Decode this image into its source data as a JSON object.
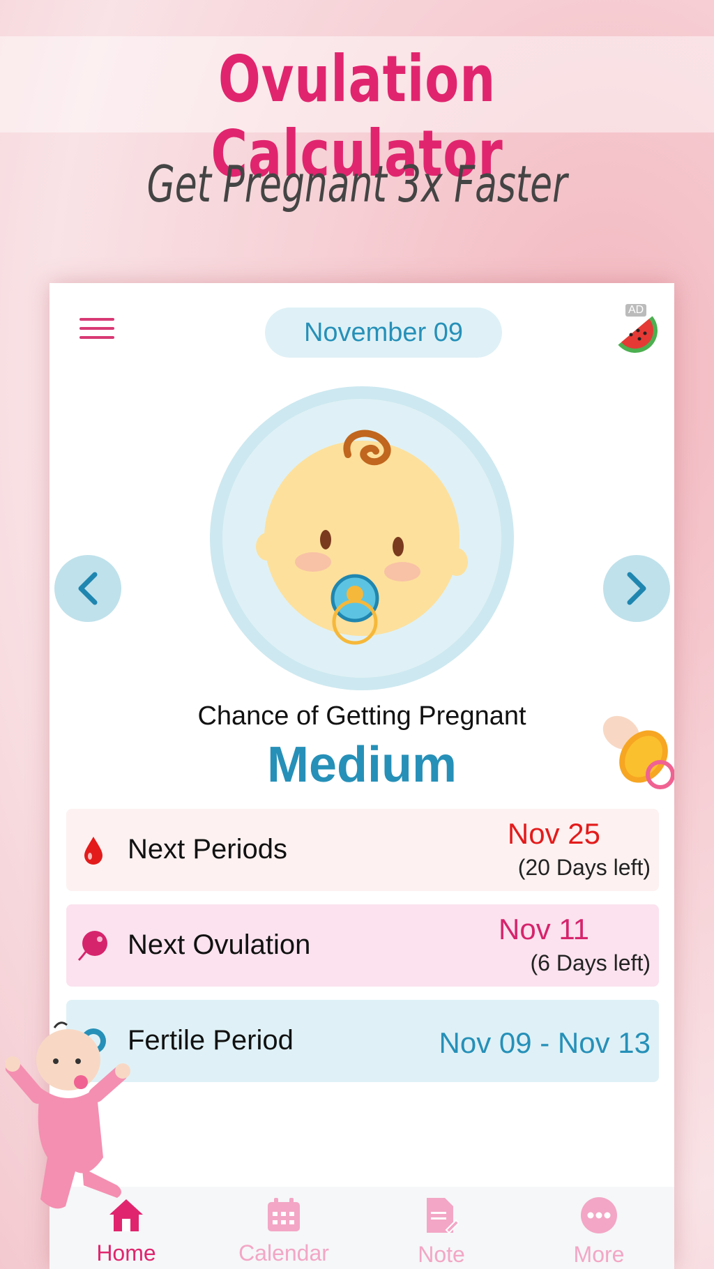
{
  "promo": {
    "title": "Ovulation Calculator",
    "subtitle": "Get Pregnant 3x Faster"
  },
  "header": {
    "date": "November  09",
    "ad_label": "AD"
  },
  "status": {
    "chance_label": "Chance of Getting Pregnant",
    "chance_value": "Medium"
  },
  "cards": [
    {
      "label": "Next Periods",
      "date": "Nov  25",
      "days_left": "(20 Days left)",
      "color": "#e31b1b"
    },
    {
      "label": "Next Ovulation",
      "date": "Nov  11",
      "days_left": "(6 Days left)",
      "color": "#d6246c"
    },
    {
      "label": "Fertile Period",
      "date": "Nov  09 - Nov  13",
      "color": "#2690b8"
    }
  ],
  "nav": [
    {
      "label": "Home",
      "icon": "home-icon",
      "active": true
    },
    {
      "label": "Calendar",
      "icon": "calendar-icon",
      "active": false
    },
    {
      "label": "Note",
      "icon": "note-icon",
      "active": false
    },
    {
      "label": "More",
      "icon": "more-icon",
      "active": false
    }
  ],
  "colors": {
    "brand_pink": "#e0256e",
    "accent_blue": "#2690b8",
    "inactive_pink": "#f3a6c5"
  }
}
